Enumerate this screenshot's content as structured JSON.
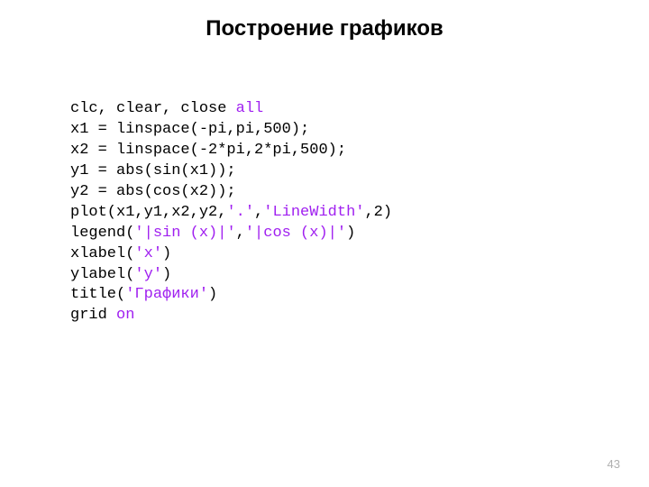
{
  "title": "Построение графиков",
  "page_number": "43",
  "code": {
    "l1a": "clc, clear, close ",
    "l1b": "all",
    "l2": "x1 = linspace(-pi,pi,500);",
    "l3": "x2 = linspace(-2*pi,2*pi,500);",
    "l4": "y1 = abs(sin(x1));",
    "l5": "y2 = abs(cos(x2));",
    "l6a": "plot(x1,y1,x2,y2,",
    "l6b": "'.'",
    "l6c": ",",
    "l6d": "'LineWidth'",
    "l6e": ",2)",
    "l7a": "legend(",
    "l7b": "'|sin (x)|'",
    "l7c": ",",
    "l7d": "'|cos (x)|'",
    "l7e": ")",
    "l8a": "xlabel(",
    "l8b": "'x'",
    "l8c": ")",
    "l9a": "ylabel(",
    "l9b": "'y'",
    "l9c": ")",
    "l10a": "title(",
    "l10b": "'Графики'",
    "l10c": ")",
    "l11a": "grid ",
    "l11b": "on"
  }
}
